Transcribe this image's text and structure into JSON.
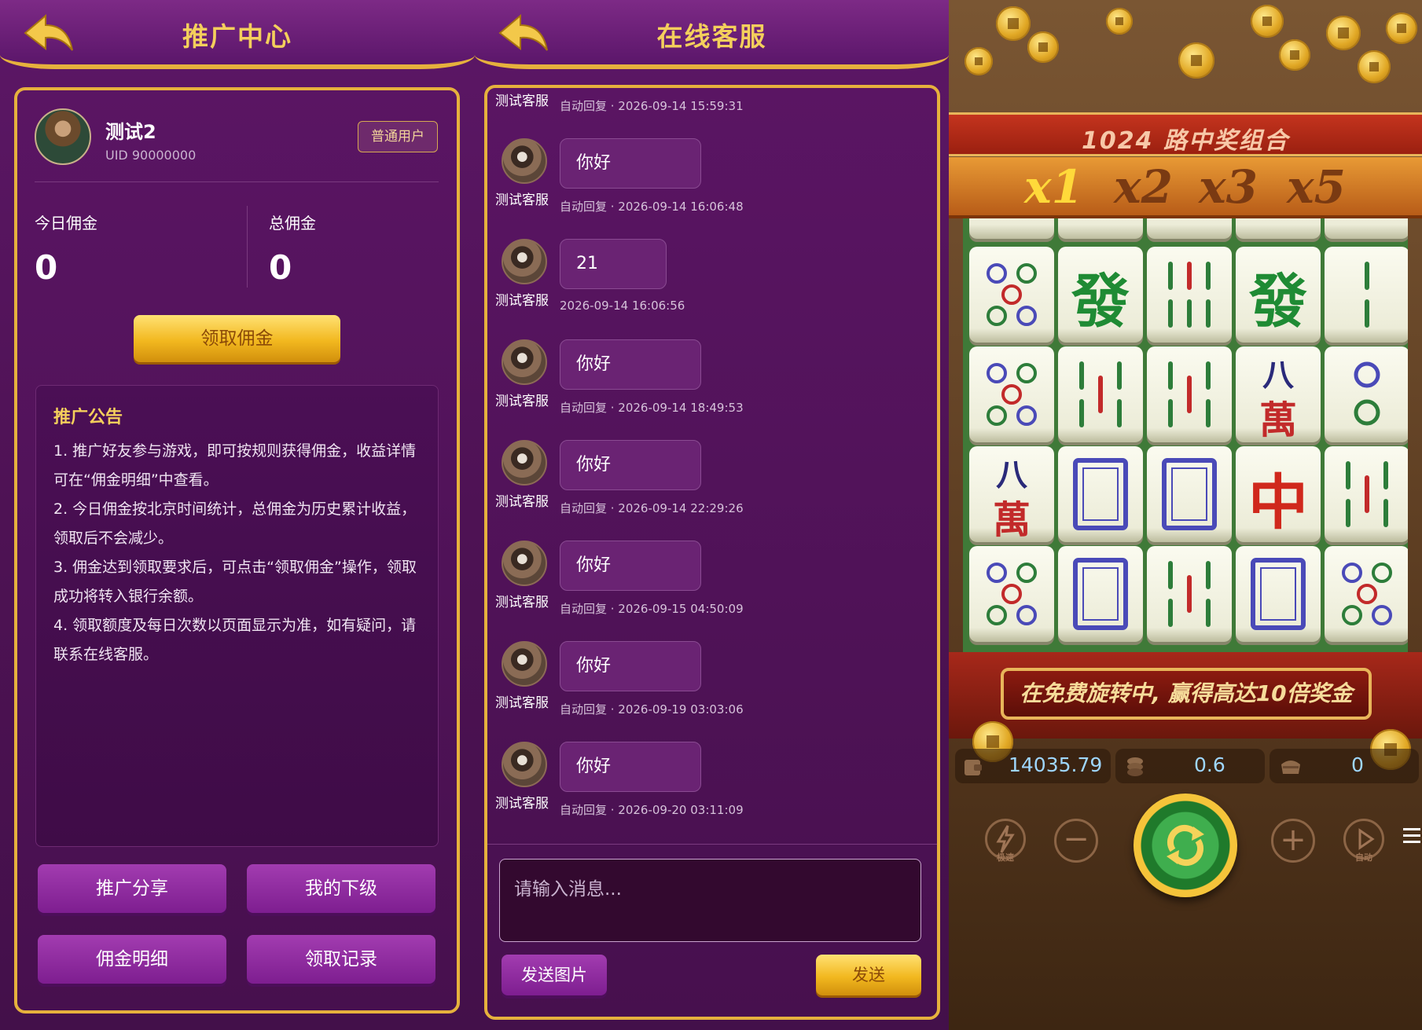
{
  "promo": {
    "title": "推广中心",
    "user": {
      "name": "测试2",
      "uid": "UID 90000000",
      "badge": "普通用户"
    },
    "today_label": "今日佣金",
    "today_value": "0",
    "total_label": "总佣金",
    "total_value": "0",
    "claim_button": "领取佣金",
    "notice_title": "推广公告",
    "notice_lines": [
      "1. 推广好友参与游戏，即可按规则获得佣金，收益详情",
      "可在“佣金明细”中查看。",
      "2. 今日佣金按北京时间统计，总佣金为历史累计收益，",
      "领取后不会减少。",
      "3. 佣金达到领取要求后，可点击“领取佣金”操作，领取",
      "成功将转入银行余额。",
      "4. 领取额度及每日次数以页面显示为准，如有疑问，请",
      "联系在线客服。"
    ],
    "buttons": [
      "推广分享",
      "我的下级",
      "佣金明细",
      "领取记录"
    ]
  },
  "support": {
    "title": "在线客服",
    "partial_top": {
      "name": "测试客服",
      "time": "自动回复 · 2026-09-14 15:59:31"
    },
    "messages": [
      {
        "name": "测试客服",
        "text": "你好",
        "time": "自动回复 · 2026-09-14 16:06:48"
      },
      {
        "name": "测试客服",
        "text": "21",
        "time": "2026-09-14 16:06:56"
      },
      {
        "name": "测试客服",
        "text": "你好",
        "time": "自动回复 · 2026-09-14 18:49:53"
      },
      {
        "name": "测试客服",
        "text": "你好",
        "time": "自动回复 · 2026-09-14 22:29:26"
      },
      {
        "name": "测试客服",
        "text": "你好",
        "time": "自动回复 · 2026-09-15 04:50:09"
      },
      {
        "name": "测试客服",
        "text": "你好",
        "time": "自动回复 · 2026-09-19 03:03:06"
      },
      {
        "name": "测试客服",
        "text": "你好",
        "time": "自动回复 · 2026-09-20 03:11:09"
      }
    ],
    "input_placeholder": "请输入消息...",
    "send_image_button": "发送图片",
    "send_button": "发送"
  },
  "game": {
    "ways_banner": "1024 路中奖组合",
    "multipliers": [
      "x1",
      "x2",
      "x3",
      "x5"
    ],
    "free_spin_banner": "在免费旋转中, 赢得高达10倍奖金",
    "balance": "14035.79",
    "bet": "0.6",
    "win": "0",
    "turbo_label": "极速",
    "auto_label": "自动",
    "tile_chars": {
      "fa": "發",
      "ba": "八",
      "wan": "萬",
      "zhong": "中"
    },
    "colors": {
      "gold": "#f4cf5c",
      "purple": "#5c1766",
      "felt": "#3f7a38"
    }
  }
}
